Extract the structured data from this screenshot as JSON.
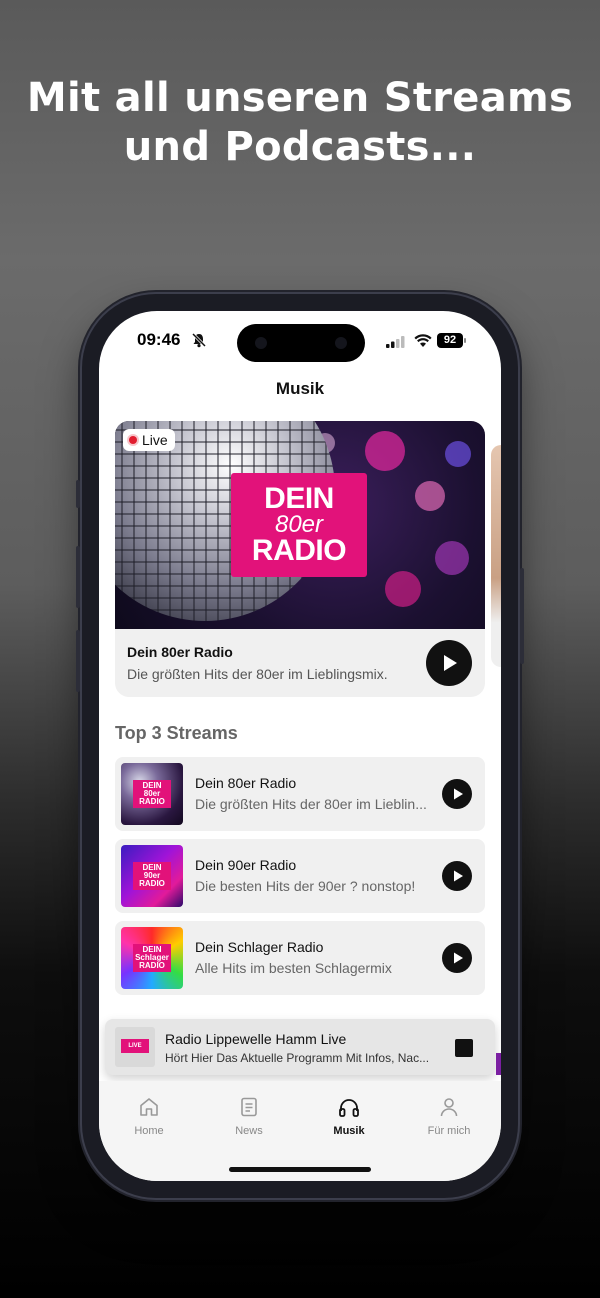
{
  "headline": [
    "Mit all unseren Streams",
    "und Podcasts..."
  ],
  "status_bar": {
    "time": "09:46",
    "battery": "92"
  },
  "page_title": "Musik",
  "featured": {
    "badge": "Live",
    "logo": [
      "DEIN",
      "80er",
      "RADIO"
    ],
    "title": "Dein 80er Radio",
    "subtitle": "Die größten Hits der 80er im Lieblingsmix."
  },
  "top_streams": {
    "title": "Top 3 Streams",
    "items": [
      {
        "title": "Dein 80er Radio",
        "subtitle": "Die größten Hits der 80er im Lieblin...",
        "logo": [
          "DEIN",
          "80er",
          "RADIO"
        ]
      },
      {
        "title": "Dein 90er Radio",
        "subtitle": "Die besten Hits der 90er ? nonstop!",
        "logo": [
          "DEIN",
          "90er",
          "RADIO"
        ]
      },
      {
        "title": "Dein Schlager Radio",
        "subtitle": "Alle Hits im besten Schlagermix",
        "logo": [
          "DEIN",
          "Schlager",
          "RADIO"
        ]
      }
    ]
  },
  "mini_player": {
    "title": "Radio Lippewelle Hamm Live",
    "subtitle": "Hört Hier Das Aktuelle Programm Mit Infos, Nac...",
    "thumb_label": "LIVE"
  },
  "tabs": [
    {
      "label": "Home",
      "icon": "home-icon"
    },
    {
      "label": "News",
      "icon": "news-icon"
    },
    {
      "label": "Musik",
      "icon": "headphones-icon",
      "active": true
    },
    {
      "label": "Für mich",
      "icon": "person-icon"
    }
  ],
  "colors": {
    "brand_pink": "#e2127a",
    "live_red": "#e11d2f",
    "accent_dark": "#111111"
  }
}
